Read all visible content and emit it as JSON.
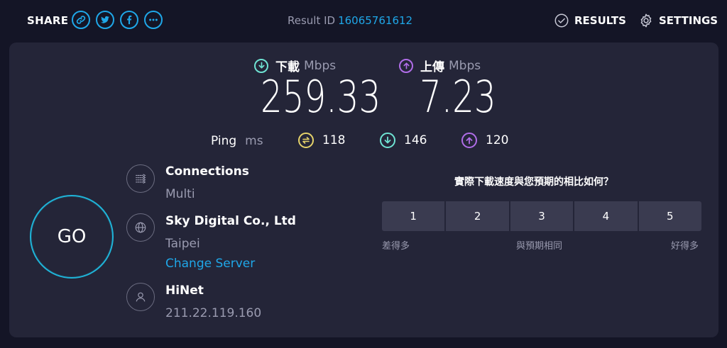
{
  "header": {
    "share_label": "SHARE",
    "share_buttons": [
      "link-icon",
      "twitter-icon",
      "facebook-icon",
      "more-icon"
    ],
    "result_id_label": "Result ID",
    "result_id": "16065761612",
    "results_label": "RESULTS",
    "settings_label": "SETTINGS"
  },
  "download": {
    "label": "下載",
    "unit": "Mbps",
    "value": "259.33",
    "icon": "download-arrow-icon",
    "color": "#6fe3d3"
  },
  "upload": {
    "label": "上傳",
    "unit": "Mbps",
    "value": "7.23",
    "icon": "upload-arrow-icon",
    "color": "#b06de8"
  },
  "ping": {
    "label": "Ping",
    "unit": "ms",
    "idle": {
      "value": "118",
      "color": "#e6d36a",
      "icon": "ping-idle-icon"
    },
    "download": {
      "value": "146",
      "color": "#6fe3d3",
      "icon": "ping-download-icon"
    },
    "upload": {
      "value": "120",
      "color": "#b06de8",
      "icon": "ping-upload-icon"
    }
  },
  "go_label": "GO",
  "connections": {
    "title": "Connections",
    "value": "Multi",
    "icon": "connections-icon"
  },
  "server": {
    "title": "Sky Digital Co., Ltd",
    "location": "Taipei",
    "change_label": "Change Server",
    "icon": "globe-icon"
  },
  "isp": {
    "title": "HiNet",
    "ip": "211.22.119.160",
    "icon": "user-icon"
  },
  "survey": {
    "question": "實際下載速度與您預期的相比如何？",
    "options": [
      "1",
      "2",
      "3",
      "4",
      "5"
    ],
    "low_label": "差得多",
    "mid_label": "與預期相同",
    "high_label": "好得多"
  },
  "colors": {
    "accent": "#1fa7e8",
    "panel": "#242538",
    "background": "#141526"
  }
}
